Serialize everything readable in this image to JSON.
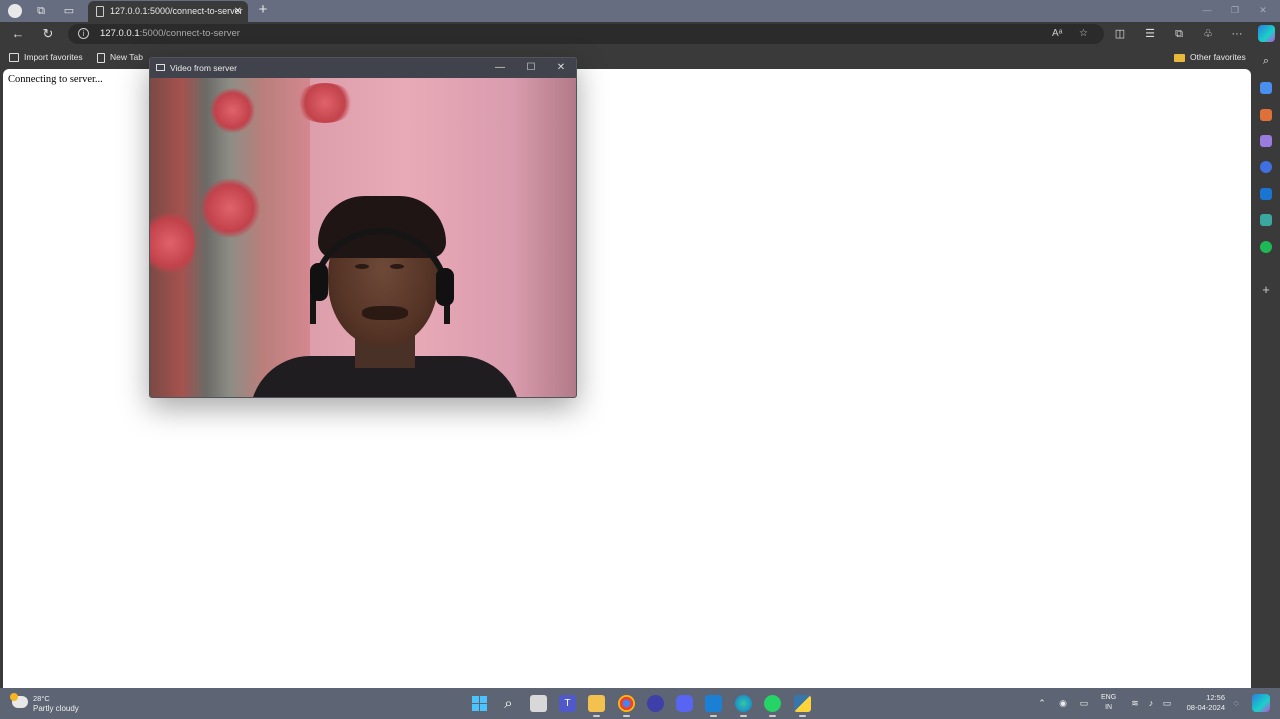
{
  "browser": {
    "tab": {
      "title": "127.0.0.1:5000/connect-to-server",
      "close": "✕"
    },
    "new_tab": "+",
    "address": {
      "host": "127.0.0.1",
      "path": ":5000/connect-to-server"
    },
    "read_aloud": "Aᵃ",
    "favorites": [
      {
        "label": "Import favorites"
      },
      {
        "label": "New Tab"
      },
      {
        "label": "Other favorites"
      }
    ]
  },
  "page": {
    "status_text": "Connecting to server..."
  },
  "video_window": {
    "title": "Video from server",
    "minimize": "—",
    "maximize": "☐",
    "close": "✕"
  },
  "taskbar": {
    "weather": {
      "temp": "28°C",
      "desc": "Partly cloudy"
    },
    "lang": {
      "line1": "ENG",
      "line2": "IN"
    },
    "clock": {
      "time": "12:56",
      "date": "08-04-2024"
    }
  },
  "colors": {
    "tab_strip": "#666d80",
    "chrome": "#3a3a3a",
    "taskbar": "#5d6473",
    "copilot_gradient": [
      "#2a7de1",
      "#1ad1c8",
      "#c44ad8"
    ]
  },
  "icons": [
    "profile-icon",
    "workspaces-icon",
    "tab-actions-icon",
    "back-icon",
    "refresh-icon",
    "info-icon",
    "favorite-star-icon",
    "split-screen-icon",
    "favorites-icon",
    "collections-icon",
    "extensions-icon",
    "more-icon",
    "copilot-icon",
    "search-icon",
    "windows-start-icon"
  ]
}
